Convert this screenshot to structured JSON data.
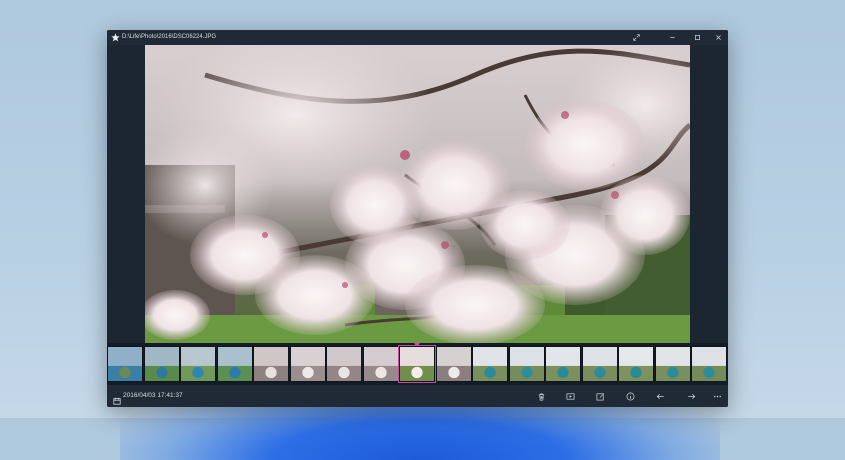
{
  "window": {
    "title": "D:\\Life\\Photo\\2016\\DSC06224.JPG"
  },
  "photo": {
    "subject": "cherry-blossom-branch"
  },
  "filmstrip": {
    "thumbnails": [
      {
        "colors": [
          "#8fb0c8",
          "#3a7fa6",
          "#6a8a5a"
        ]
      },
      {
        "colors": [
          "#a0b8c6",
          "#5a8a4a",
          "#2d7aa0"
        ]
      },
      {
        "colors": [
          "#b8c6cf",
          "#6f9a5a",
          "#2f86b0"
        ]
      },
      {
        "colors": [
          "#aac0cc",
          "#5c8f52",
          "#2a7cab"
        ]
      },
      {
        "colors": [
          "#cfc6c6",
          "#8e8080",
          "#e8e0e0"
        ]
      },
      {
        "colors": [
          "#d8d0d2",
          "#9a8e8f",
          "#efe8e8"
        ]
      },
      {
        "colors": [
          "#d0c8ca",
          "#948687",
          "#ece4e4"
        ]
      },
      {
        "colors": [
          "#d4ccce",
          "#988a8b",
          "#eee6e6"
        ]
      },
      {
        "colors": [
          "#e6dede",
          "#6f8f4a",
          "#f4eded"
        ]
      },
      {
        "colors": [
          "#d6d0d0",
          "#8a7e7e",
          "#efe9e9"
        ]
      },
      {
        "colors": [
          "#e0e4e8",
          "#7a8e5e",
          "#2a8c9a"
        ]
      },
      {
        "colors": [
          "#dde2e6",
          "#778c5c",
          "#2b8e98"
        ]
      },
      {
        "colors": [
          "#e2e6ea",
          "#7c905f",
          "#2a8a96"
        ]
      },
      {
        "colors": [
          "#dfe3e7",
          "#798d5d",
          "#2c8c99"
        ]
      },
      {
        "colors": [
          "#e4e8ea",
          "#7e9260",
          "#2a8a94"
        ]
      },
      {
        "colors": [
          "#e1e5e8",
          "#7b8f5e",
          "#2b8b97"
        ]
      },
      {
        "colors": [
          "#dee2e6",
          "#768a5a",
          "#2d8d99"
        ]
      }
    ],
    "selected_index": 8
  },
  "status": {
    "datetime": "2016/04/03 17:41:37"
  },
  "toolbar": {
    "actions": [
      {
        "name": "delete-icon"
      },
      {
        "name": "slideshow-icon"
      },
      {
        "name": "edit-icon"
      },
      {
        "name": "info-icon"
      },
      {
        "name": "previous-arrow-icon"
      },
      {
        "name": "next-arrow-icon"
      },
      {
        "name": "more-icon"
      }
    ]
  },
  "colors": {
    "window_bg": "#1f2a36",
    "accent_selected": "#d04ab0",
    "text": "#d8dde3"
  }
}
